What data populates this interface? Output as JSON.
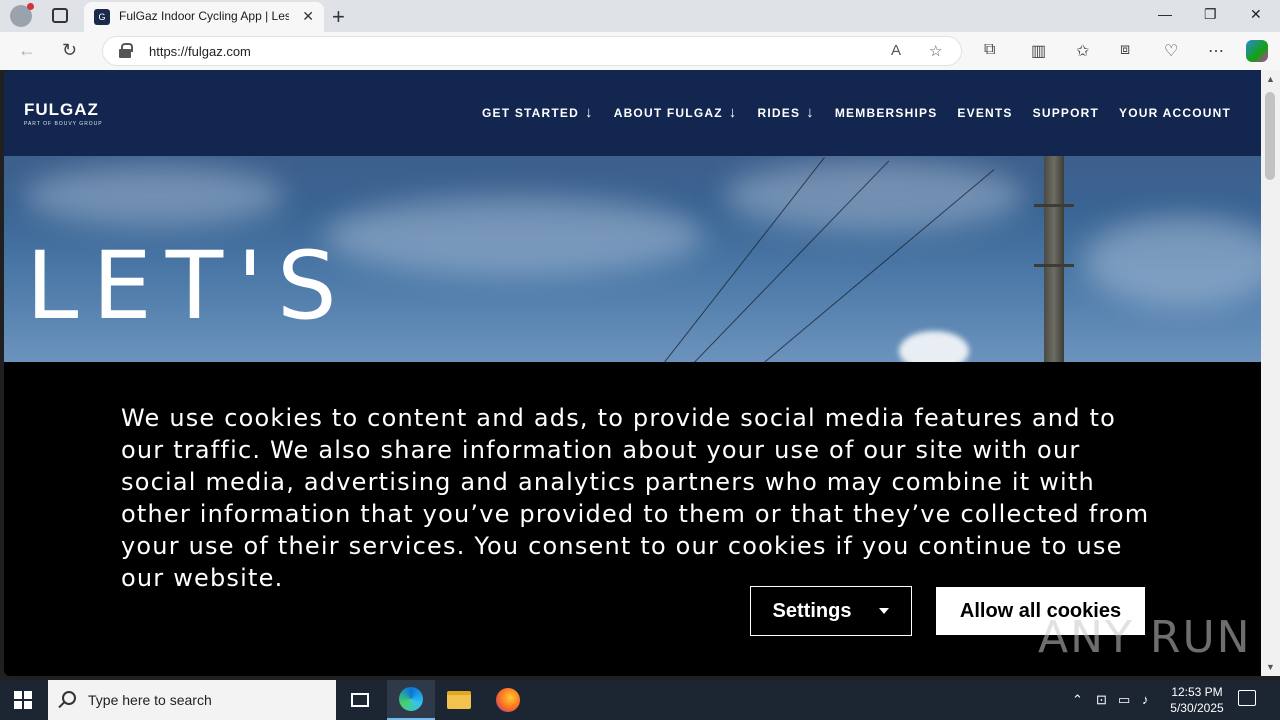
{
  "browser": {
    "tab_title": "FulGaz Indoor Cycling App | Less",
    "url": "https://fulgaz.com",
    "new_tab": "+",
    "window_controls": {
      "minimize": "—",
      "restore": "❐",
      "close": "✕"
    }
  },
  "site": {
    "logo": {
      "main": "FULGAZ",
      "sub": "PART OF BOUVY GROUP"
    },
    "nav": [
      {
        "label": "GET STARTED",
        "has_dropdown": true
      },
      {
        "label": "ABOUT FULGAZ",
        "has_dropdown": true
      },
      {
        "label": "RIDES",
        "has_dropdown": true
      },
      {
        "label": "MEMBERSHIPS",
        "has_dropdown": false
      },
      {
        "label": "EVENTS",
        "has_dropdown": false
      },
      {
        "label": "SUPPORT",
        "has_dropdown": false
      },
      {
        "label": "YOUR ACCOUNT",
        "has_dropdown": false
      }
    ],
    "hero_title": "LET'S"
  },
  "cookie_banner": {
    "text": "We use cookies to content and ads, to provide social media features and to our traffic. We also share information about your use of our site with our social media, advertising and analytics partners who may combine it with other information that you’ve provided to them or that they’ve collected from your use of their services. You consent to our cookies if you continue to use our website.",
    "settings_label": "Settings",
    "allow_label": "Allow all cookies"
  },
  "watermark": "ANY RUN",
  "taskbar": {
    "search_placeholder": "Type here to search",
    "time": "12:53 PM",
    "date": "5/30/2025"
  },
  "colors": {
    "header_bg": "#12264f",
    "banner_bg": "#000000",
    "button_bg": "#ffffff"
  }
}
